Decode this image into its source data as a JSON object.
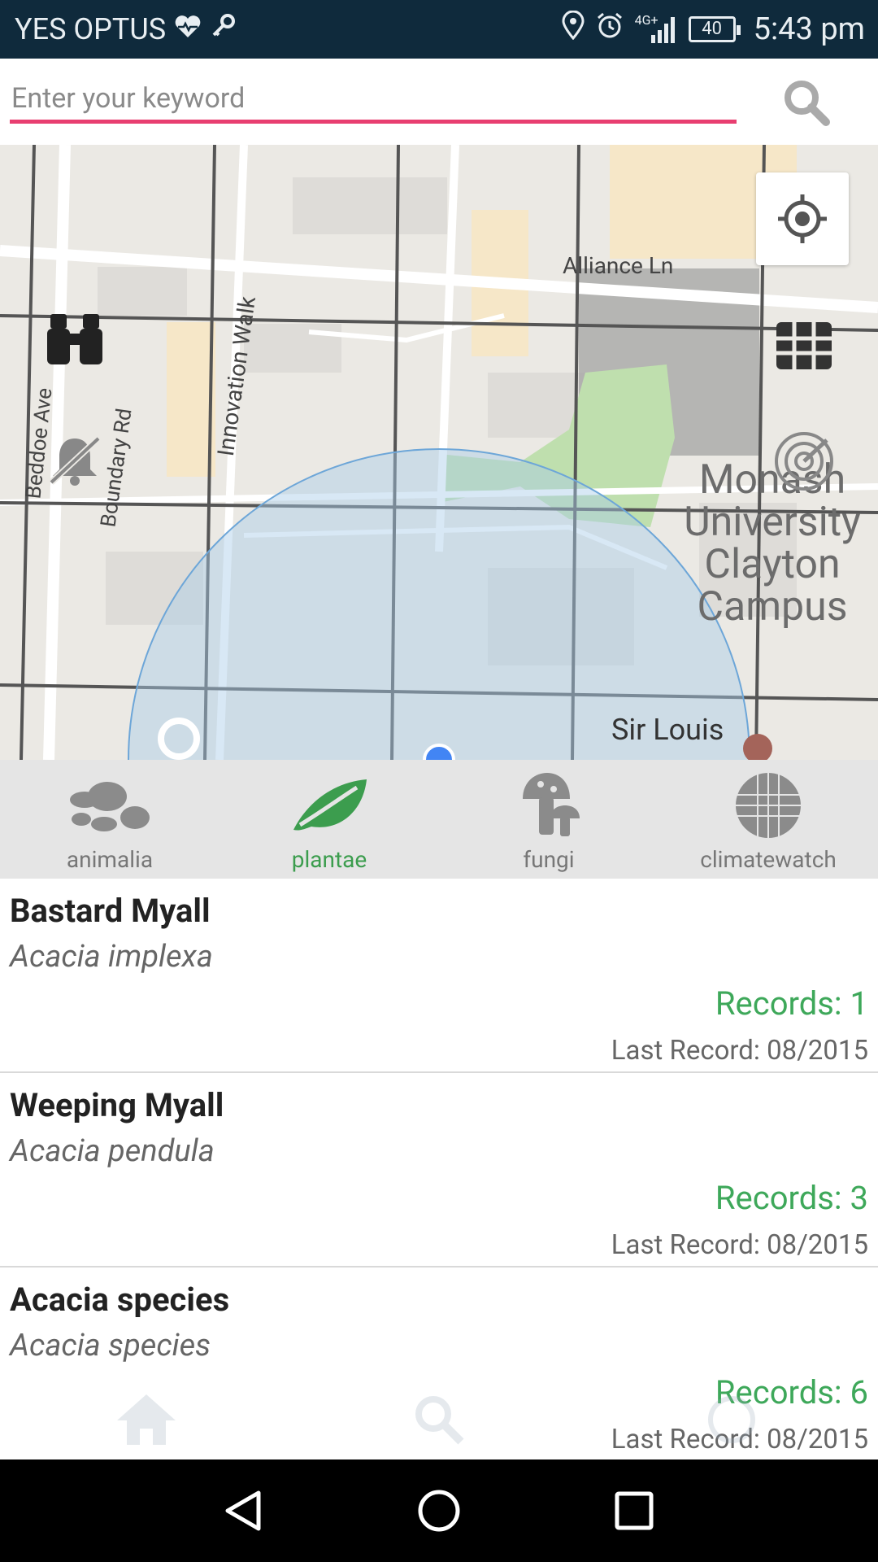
{
  "status_bar": {
    "carrier": "YES OPTUS",
    "network": "4G+",
    "battery": "40",
    "time": "5:43 pm"
  },
  "search": {
    "placeholder": "Enter your keyword"
  },
  "map": {
    "labels": {
      "alliance_ln": "Alliance Ln",
      "innovation_walk": "Innovation Walk",
      "beddoe_ave": "Beddoe Ave",
      "boundary_rd": "Boundary Rd",
      "monash": [
        "Monash",
        "University",
        "Clayton",
        "Campus"
      ],
      "sir_louis": "Sir Louis"
    }
  },
  "categories": [
    {
      "label": "animalia",
      "icon": "paw-icon",
      "active": false
    },
    {
      "label": "plantae",
      "icon": "leaf-icon",
      "active": true
    },
    {
      "label": "fungi",
      "icon": "mushroom-icon",
      "active": false
    },
    {
      "label": "climatewatch",
      "icon": "globe-icon",
      "active": false
    }
  ],
  "results": [
    {
      "common": "Bastard Myall",
      "scientific": "Acacia implexa",
      "records": "Records: 1",
      "last_record": "Last Record: 08/2015"
    },
    {
      "common": "Weeping Myall",
      "scientific": "Acacia pendula",
      "records": "Records: 3",
      "last_record": "Last Record: 08/2015"
    },
    {
      "common": "Acacia species",
      "scientific": "Acacia species",
      "records": "Records: 6",
      "last_record": "Last Record: 08/2015"
    }
  ],
  "colors": {
    "status_bar_bg": "#0f2a3c",
    "search_underline": "#e83e70",
    "active_green": "#3c9d4e",
    "records_green": "#3ea85a"
  }
}
